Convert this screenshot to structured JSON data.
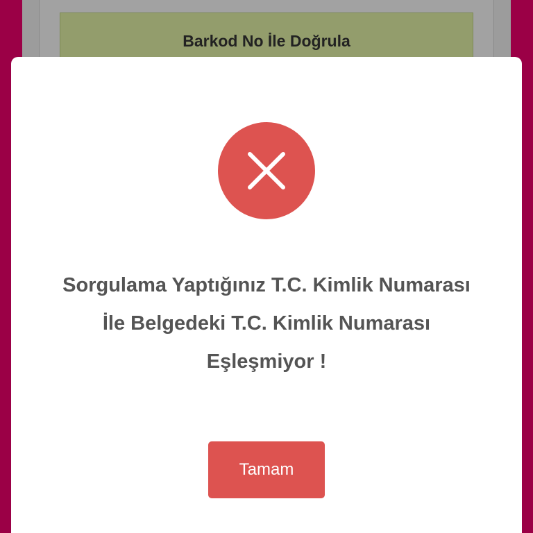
{
  "background": {
    "barcode_button_label": "Barkod No İle Doğrula"
  },
  "modal": {
    "icon": "error-x-icon",
    "message": "Sorgulama Yaptığınız T.C. Kimlik Numarası İle Belgedeki T.C. Kimlik Numarası Eşleşmiyor !",
    "ok_label": "Tamam"
  },
  "colors": {
    "page_background": "#9b0046",
    "error_red": "#dd5350",
    "barcode_button": "#939d6c",
    "message_text": "#545454"
  }
}
